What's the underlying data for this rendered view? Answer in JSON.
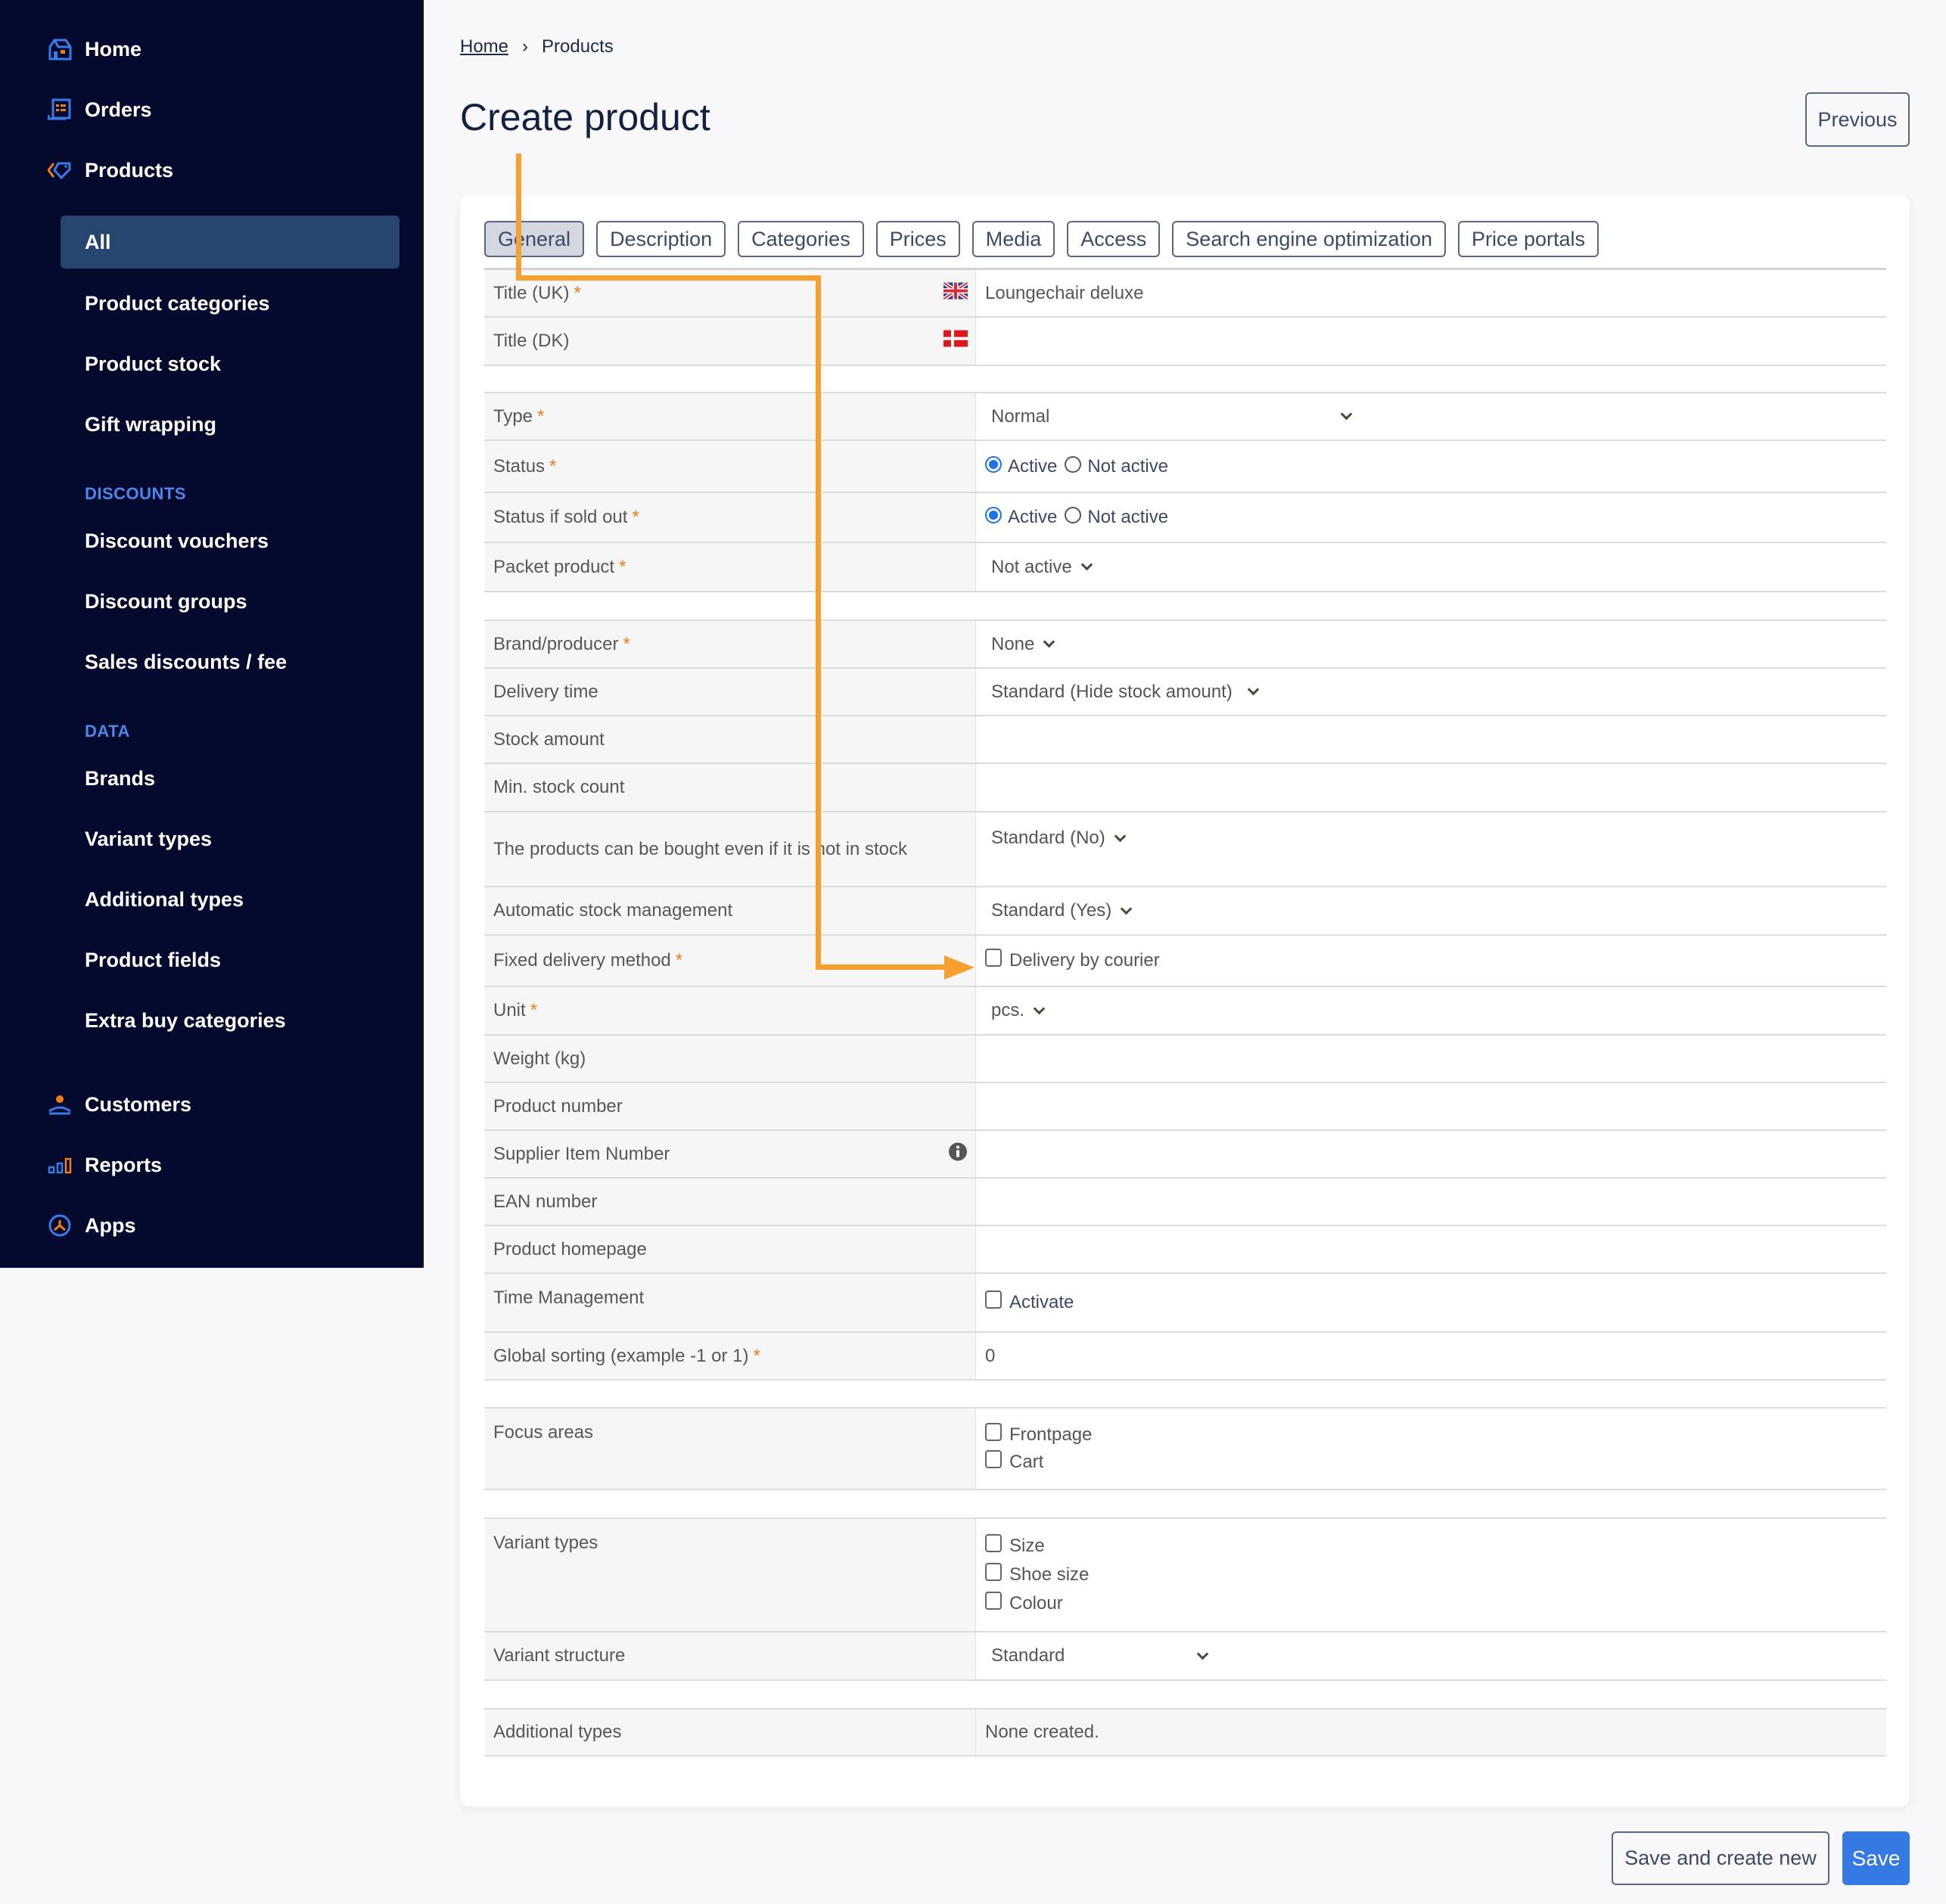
{
  "sidebar": {
    "items": [
      {
        "label": "Home",
        "icon": "home-icon"
      },
      {
        "label": "Orders",
        "icon": "orders-icon"
      },
      {
        "label": "Products",
        "icon": "tag-icon"
      }
    ],
    "products_sub": [
      {
        "label": "All",
        "active": true
      },
      {
        "label": "Product categories"
      },
      {
        "label": "Product stock"
      },
      {
        "label": "Gift wrapping"
      }
    ],
    "discounts_heading": "DISCOUNTS",
    "discounts": [
      {
        "label": "Discount vouchers"
      },
      {
        "label": "Discount groups"
      },
      {
        "label": "Sales discounts / fee"
      }
    ],
    "data_heading": "DATA",
    "data": [
      {
        "label": "Brands"
      },
      {
        "label": "Variant types"
      },
      {
        "label": "Additional types"
      },
      {
        "label": "Product fields"
      },
      {
        "label": "Extra buy categories"
      }
    ],
    "bottom": [
      {
        "label": "Customers",
        "icon": "customers-icon"
      },
      {
        "label": "Reports",
        "icon": "reports-icon"
      },
      {
        "label": "Apps",
        "icon": "apps-icon"
      }
    ]
  },
  "breadcrumb": {
    "home": "Home",
    "separator": "›",
    "current": "Products"
  },
  "page": {
    "title": "Create product",
    "previous_label": "Previous"
  },
  "tabs": [
    {
      "label": "General",
      "active": true
    },
    {
      "label": "Description"
    },
    {
      "label": "Categories"
    },
    {
      "label": "Prices"
    },
    {
      "label": "Media"
    },
    {
      "label": "Access"
    },
    {
      "label": "Search engine optimization"
    },
    {
      "label": "Price portals"
    }
  ],
  "form": {
    "required_mark": "*",
    "title_uk": {
      "label": "Title (UK)",
      "value": "Loungechair deluxe",
      "flag": "uk-flag-icon"
    },
    "title_dk": {
      "label": "Title (DK)",
      "value": "",
      "flag": "dk-flag-icon"
    },
    "type": {
      "label": "Type",
      "value": "Normal"
    },
    "status": {
      "label": "Status",
      "options": [
        "Active",
        "Not active"
      ],
      "selected": "Active"
    },
    "status_sold_out": {
      "label": "Status if sold out",
      "options": [
        "Active",
        "Not active"
      ],
      "selected": "Active"
    },
    "packet_product": {
      "label": "Packet product",
      "value": "Not active"
    },
    "brand": {
      "label": "Brand/producer",
      "value": "None"
    },
    "delivery_time": {
      "label": "Delivery time",
      "value": "Standard (Hide stock amount)"
    },
    "stock_amount": {
      "label": "Stock amount",
      "value": ""
    },
    "min_stock": {
      "label": "Min. stock count",
      "value": ""
    },
    "buy_not_in_stock": {
      "label": "The products can be bought even if it is not in stock",
      "value": "Standard (No)"
    },
    "auto_stock": {
      "label": "Automatic stock management",
      "value": "Standard (Yes)"
    },
    "fixed_delivery": {
      "label": "Fixed delivery method",
      "option": "Delivery by courier",
      "checked": false
    },
    "unit": {
      "label": "Unit",
      "value": "pcs."
    },
    "weight": {
      "label": "Weight (kg)",
      "value": ""
    },
    "product_number": {
      "label": "Product number",
      "value": ""
    },
    "supplier_item": {
      "label": "Supplier Item Number",
      "value": ""
    },
    "ean": {
      "label": "EAN number",
      "value": ""
    },
    "homepage": {
      "label": "Product homepage",
      "value": ""
    },
    "time_management": {
      "label": "Time Management",
      "option": "Activate",
      "checked": false
    },
    "global_sorting": {
      "label": "Global sorting (example -1 or 1)",
      "value": "0"
    },
    "focus_areas": {
      "label": "Focus areas",
      "options": [
        "Frontpage",
        "Cart"
      ]
    },
    "variant_types": {
      "label": "Variant types",
      "options": [
        "Size",
        "Shoe size",
        "Colour"
      ]
    },
    "variant_structure": {
      "label": "Variant structure",
      "value": "Standard"
    },
    "additional_types": {
      "label": "Additional types",
      "value": "None created."
    }
  },
  "actions": {
    "save_new": "Save and create new",
    "save": "Save"
  },
  "colors": {
    "sidebar_bg": "#030a2e",
    "active_item": "#26466f",
    "accent": "#3579e3",
    "annotation": "#f7a032",
    "required": "#f07c1a"
  }
}
